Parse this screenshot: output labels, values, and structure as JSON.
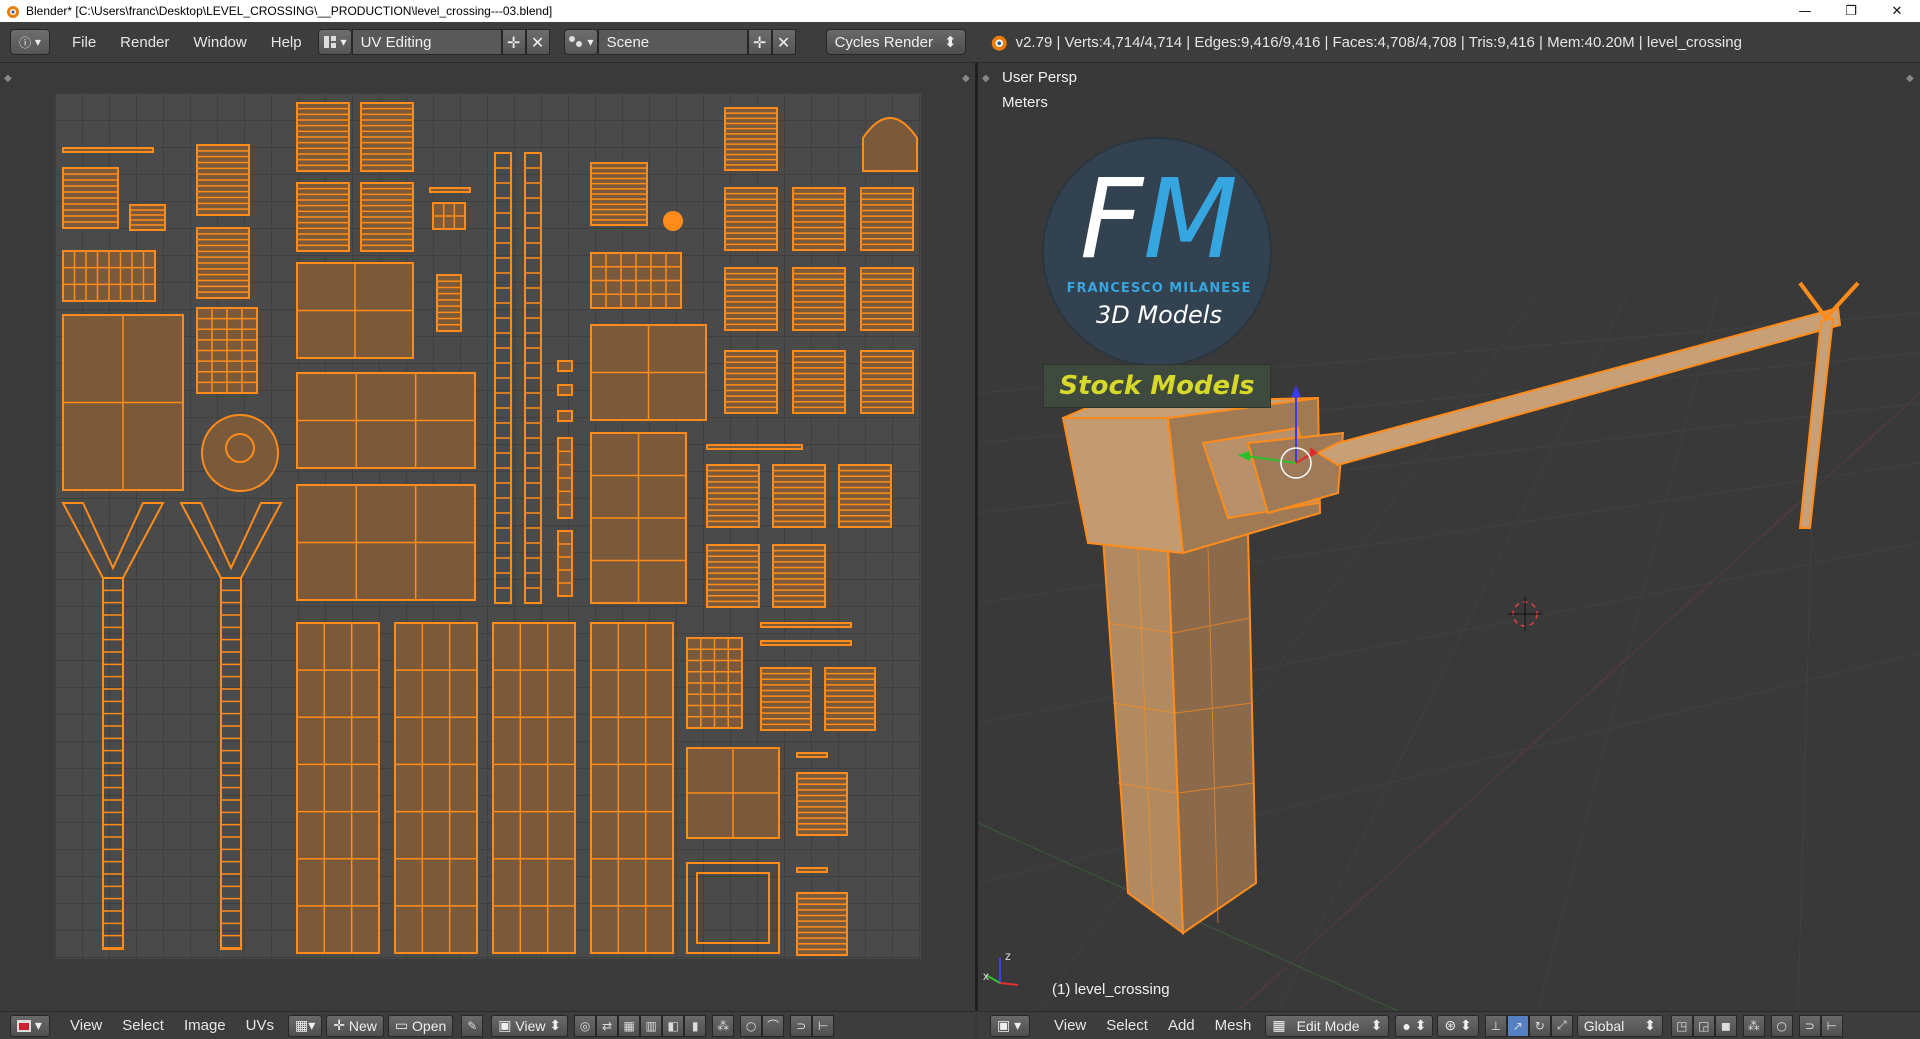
{
  "window": {
    "title": "Blender* [C:\\Users\\franc\\Desktop\\LEVEL_CROSSING\\__PRODUCTION\\level_crossing---03.blend]",
    "minimize": "—",
    "restore": "❐",
    "close": "✕"
  },
  "top_menu": {
    "info_icon": "ⓘ",
    "file": "File",
    "render": "Render",
    "window": "Window",
    "help": "Help",
    "layout": "UV Editing",
    "scene": "Scene",
    "engine": "Cycles Render",
    "stats": "v2.79 | Verts:4,714/4,714 | Edges:9,416/9,416 | Faces:4,708/4,708 | Tris:9,416 | Mem:40.20M | level_crossing"
  },
  "viewport": {
    "view_name": "User Persp",
    "units": "Meters",
    "object_label": "(1) level_crossing",
    "axis_x": "x",
    "axis_z": "z"
  },
  "logo": {
    "f": "F",
    "m": "M",
    "subtitle": "FRANCESCO MILANESE",
    "tagline": "3D Models",
    "badge": "Stock Models"
  },
  "uv_header": {
    "view": "View",
    "select": "Select",
    "image": "Image",
    "uvs": "UVs",
    "new": "New",
    "open": "Open",
    "view2": "View"
  },
  "view3d_header": {
    "view": "View",
    "select": "Select",
    "add": "Add",
    "mesh": "Mesh",
    "mode": "Edit Mode",
    "orientation": "Global"
  },
  "colors": {
    "uv_orange": "#ff8c1a",
    "uv_fill": "#7a5a3a",
    "logo_blue": "#36a6e0",
    "badge_yellow": "#d6d82a"
  }
}
